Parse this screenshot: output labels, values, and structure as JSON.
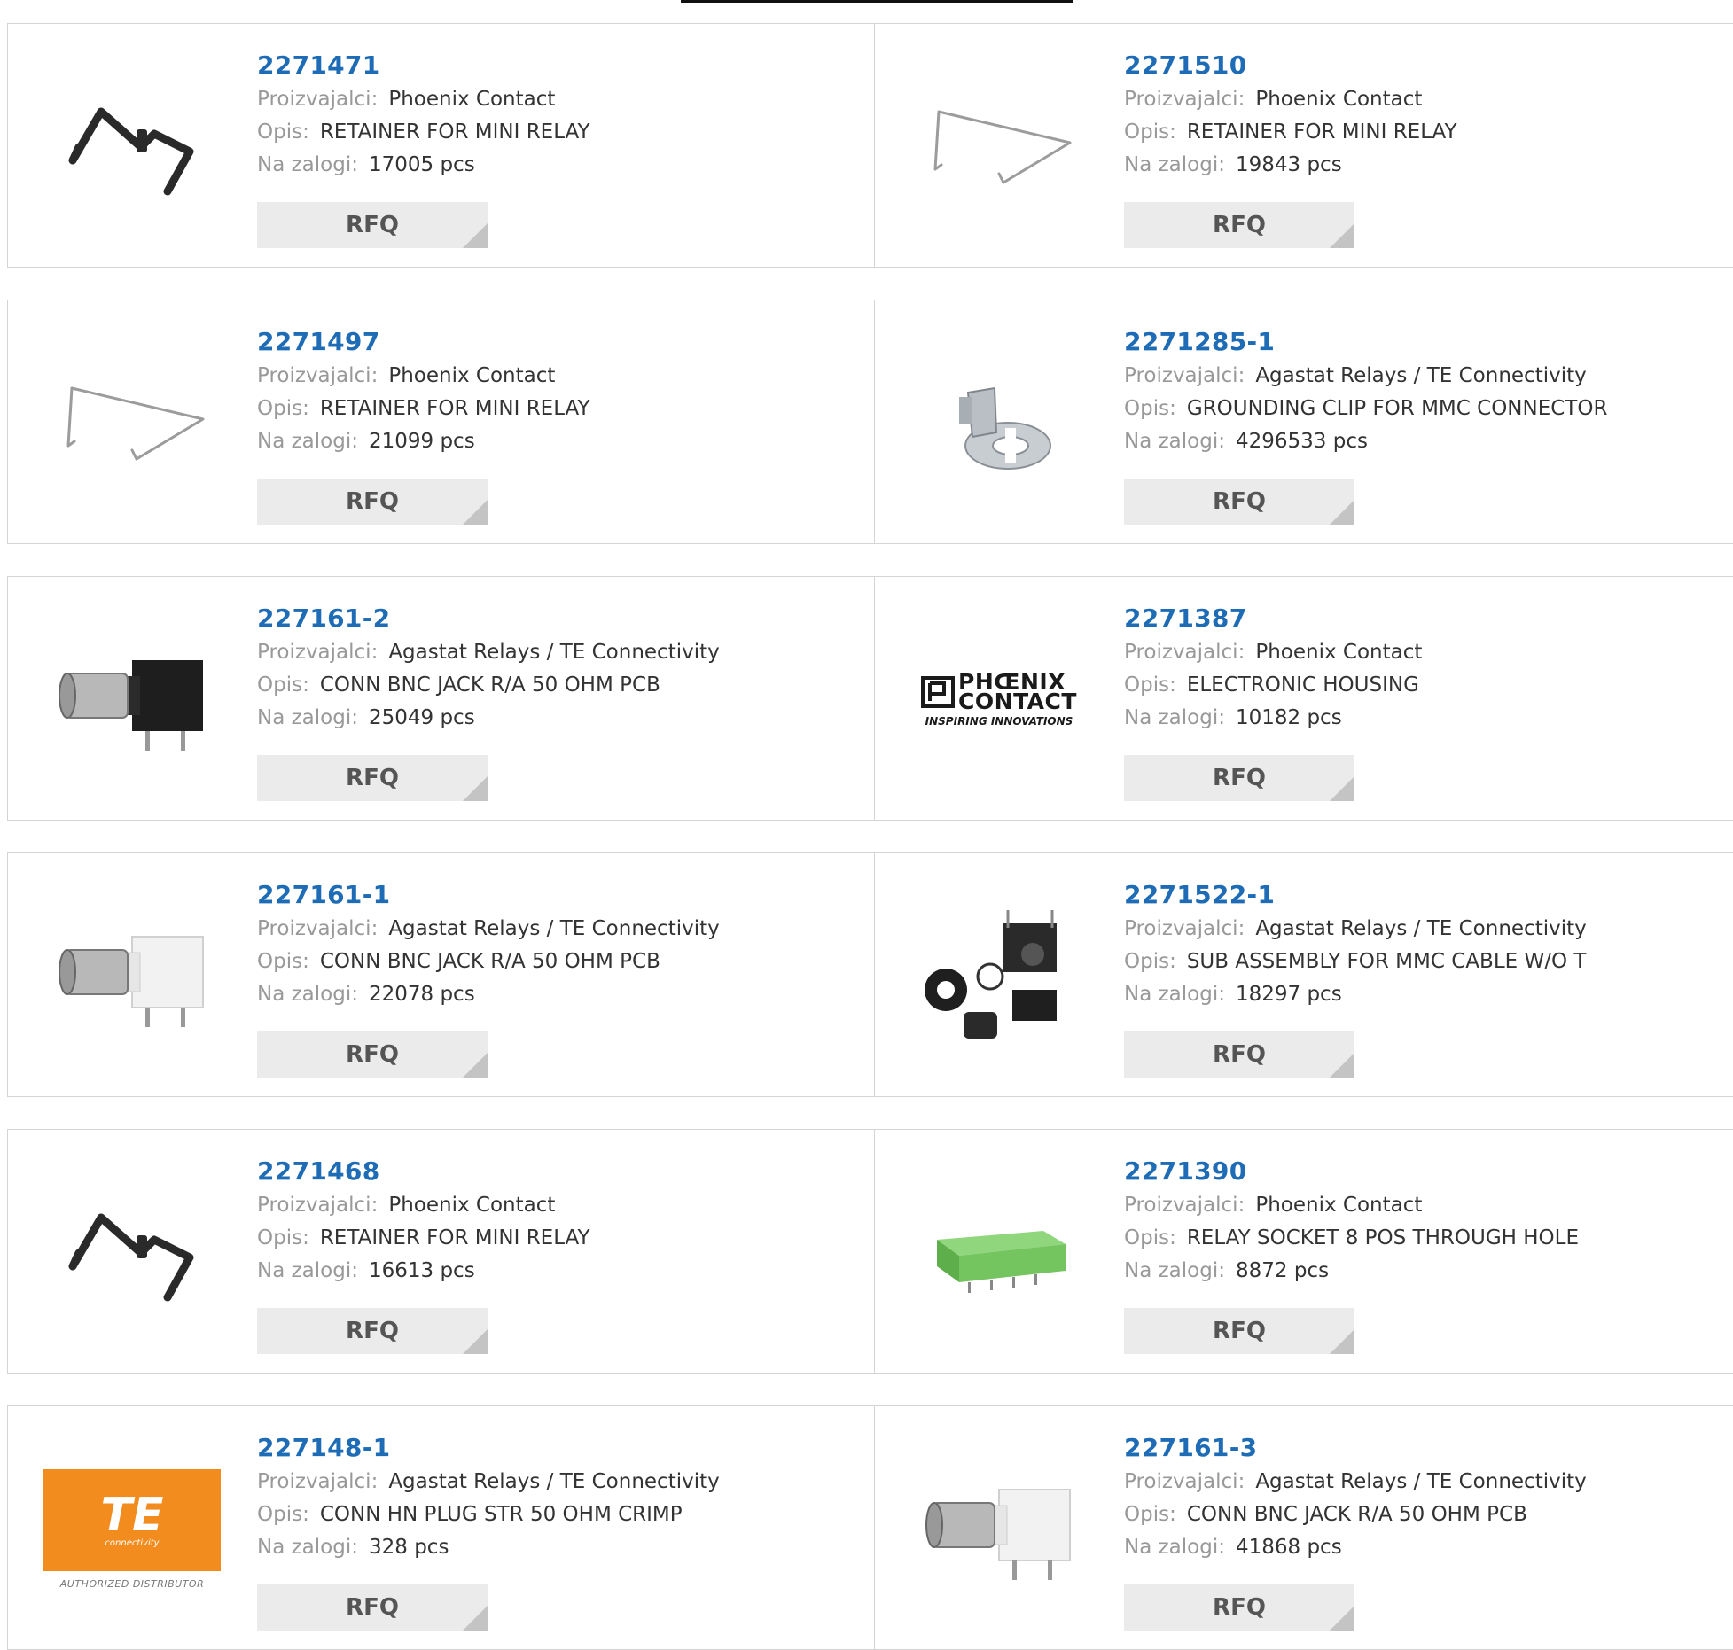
{
  "labels": {
    "manufacturer": "Proizvajalci:",
    "description": "Opis:",
    "stock": "Na zalogi:",
    "rfq": "RFQ"
  },
  "colors": {
    "part_link": "#1d6cb5",
    "label_text": "#999999",
    "value_text": "#333333",
    "rfq_bg": "#ebebeb",
    "card_border": "#d4d4d4"
  },
  "products": [
    {
      "part": "2271471",
      "manufacturer": "Phoenix Contact",
      "description": "RETAINER FOR MINI RELAY",
      "stock": "17005 pcs",
      "image": "black-retainer-clip"
    },
    {
      "part": "2271510",
      "manufacturer": "Phoenix Contact",
      "description": "RETAINER FOR MINI RELAY",
      "stock": "19843 pcs",
      "image": "wire-retainer-clip"
    },
    {
      "part": "2271497",
      "manufacturer": "Phoenix Contact",
      "description": "RETAINER FOR MINI RELAY",
      "stock": "21099 pcs",
      "image": "wire-retainer-clip"
    },
    {
      "part": "2271285-1",
      "manufacturer": "Agastat Relays / TE Connectivity",
      "description": "GROUNDING CLIP FOR MMC CONNECTOR",
      "stock": "4296533 pcs",
      "image": "grounding-clip"
    },
    {
      "part": "227161-2",
      "manufacturer": "Agastat Relays / TE Connectivity",
      "description": "CONN BNC JACK R/A 50 OHM PCB",
      "stock": "25049 pcs",
      "image": "bnc-jack-black"
    },
    {
      "part": "2271387",
      "manufacturer": "Phoenix Contact",
      "description": "ELECTRONIC HOUSING",
      "stock": "10182 pcs",
      "image": "phoenix-contact-logo",
      "logo_line1": "PHŒNIX",
      "logo_line2": "CONTACT",
      "logo_tagline": "INSPIRING INNOVATIONS"
    },
    {
      "part": "227161-1",
      "manufacturer": "Agastat Relays / TE Connectivity",
      "description": "CONN BNC JACK R/A 50 OHM PCB",
      "stock": "22078 pcs",
      "image": "bnc-jack-white"
    },
    {
      "part": "2271522-1",
      "manufacturer": "Agastat Relays / TE Connectivity",
      "description": "SUB ASSEMBLY FOR MMC CABLE W/O T",
      "stock": "18297 pcs",
      "image": "cable-sub-assembly"
    },
    {
      "part": "2271468",
      "manufacturer": "Phoenix Contact",
      "description": "RETAINER FOR MINI RELAY",
      "stock": "16613 pcs",
      "image": "black-retainer-clip"
    },
    {
      "part": "2271390",
      "manufacturer": "Phoenix Contact",
      "description": "RELAY SOCKET 8 POS THROUGH HOLE",
      "stock": "8872 pcs",
      "image": "green-relay-socket"
    },
    {
      "part": "227148-1",
      "manufacturer": "Agastat Relays / TE Connectivity",
      "description": "CONN HN PLUG STR 50 OHM CRIMP",
      "stock": "328 pcs",
      "image": "te-connectivity-logo",
      "logo_text": "TE",
      "logo_subtext": "connectivity",
      "logo_caption": "AUTHORIZED DISTRIBUTOR"
    },
    {
      "part": "227161-3",
      "manufacturer": "Agastat Relays / TE Connectivity",
      "description": "CONN BNC JACK R/A 50 OHM PCB",
      "stock": "41868 pcs",
      "image": "bnc-jack-white"
    }
  ]
}
